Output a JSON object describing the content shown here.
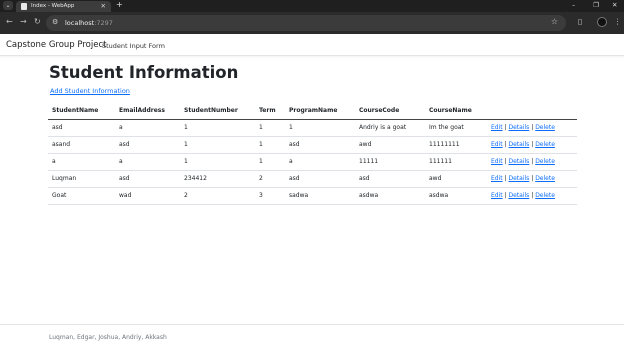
{
  "browser": {
    "tab_title": "Index - WebApp",
    "tab_close": "✕",
    "new_tab": "+",
    "url_host": "localhost",
    "url_port": ":7297",
    "win_minimize": "–",
    "win_maximize": "❐",
    "win_close": "✕"
  },
  "navbar": {
    "brand": "Capstone Group Project",
    "link": "Student Input Form"
  },
  "main": {
    "title": "Student Information",
    "add_link": "Add Student Information"
  },
  "table": {
    "headers": [
      "StudentName",
      "EmailAddress",
      "StudentNumber",
      "Term",
      "ProgramName",
      "CourseCode",
      "CourseName"
    ],
    "rows": [
      [
        "asd",
        "a",
        "1",
        "1",
        "1",
        "Andriy is a goat",
        "Im the goat"
      ],
      [
        "asand",
        "asd",
        "1",
        "1",
        "asd",
        "awd",
        "11111111"
      ],
      [
        "a",
        "a",
        "1",
        "1",
        "a",
        "11111",
        "111111"
      ],
      [
        "Luqman",
        "asd",
        "234412",
        "2",
        "asd",
        "asd",
        "awd"
      ],
      [
        "Goat",
        "wad",
        "2",
        "3",
        "sadwa",
        "asdwa",
        "asdwa"
      ]
    ],
    "actions": {
      "edit": "Edit",
      "details": "Details",
      "delete": "Delete",
      "separator": "|"
    }
  },
  "footer": {
    "text": "Luqman, Edgar, Joshua, Andriy, Akkash"
  },
  "icons": [
    "tab-list-icon",
    "page-favicon-icon",
    "back-arrow-icon",
    "forward-arrow-icon",
    "reload-icon",
    "site-info-icon",
    "bookmark-star-icon",
    "extensions-icon",
    "sidebar-icon",
    "profile-avatar-icon",
    "more-menu-icon"
  ],
  "colors": {
    "link": "#0d6efd",
    "chrome_dark": "#2b2b2b"
  }
}
